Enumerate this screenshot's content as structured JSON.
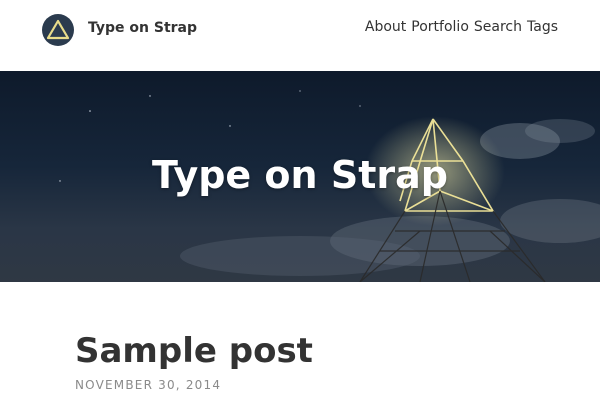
{
  "header": {
    "logo_icon": "triangle-logo-icon",
    "site_title": "Type on Strap",
    "nav": [
      {
        "label": "About"
      },
      {
        "label": "Portfolio"
      },
      {
        "label": "Search"
      },
      {
        "label": "Tags"
      }
    ]
  },
  "hero": {
    "title": "Type on Strap"
  },
  "post": {
    "title": "Sample post",
    "date": "NOVEMBER 30, 2014"
  },
  "colors": {
    "logo_bg": "#2b3b4e",
    "logo_triangle": "#e8dc8a",
    "text": "#333333",
    "date": "#8a8a8a",
    "hero_night": "#16263a"
  }
}
